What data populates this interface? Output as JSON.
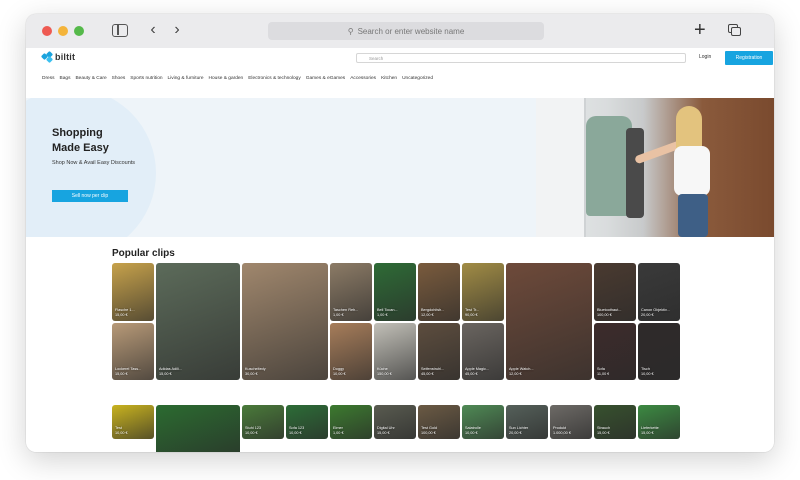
{
  "browser": {
    "url_placeholder": "Search or enter website name"
  },
  "site": {
    "logo_text": "biltit",
    "search_placeholder": "Search",
    "login_label": "Login",
    "register_label": "Registration",
    "categories": [
      "Dress",
      "Bags",
      "Beauty & Care",
      "Shoes",
      "Sports nutrition",
      "Living & furniture",
      "House & garden",
      "Electronics & technology",
      "Games & eGames",
      "Accessories",
      "Kitchen",
      "Uncategorized"
    ]
  },
  "hero": {
    "title_line1": "Shopping",
    "title_line2": "Made Easy",
    "subtitle": "Shop Now & Avail Easy Discounts",
    "button_label": "Sell now per clip"
  },
  "popular": {
    "title": "Popular clips",
    "clips": [
      {
        "label": "Flasche 1...",
        "price": "15,00 €",
        "color": "#c7a24b"
      },
      {
        "label": "Adidas Adili...",
        "price": "15,00 €",
        "color": "#5c6b5a"
      },
      {
        "label": "Kuscheltedy",
        "price": "30,00 €",
        "color": "#a0876d"
      },
      {
        "label": "Taschen Reh...",
        "price": "1,00 €",
        "color": "#8c7b66"
      },
      {
        "label": "Bell Tocan...",
        "price": "1,00 €",
        "color": "#2e6b36"
      },
      {
        "label": "Bergdohitsh...",
        "price": "12,00 €",
        "color": "#7a5b3d"
      },
      {
        "label": "Test Tr...",
        "price": "90,00 €",
        "color": "#a18c45"
      },
      {
        "label": "Apple Watch...",
        "price": "12,00 €",
        "color": "#6e4a3a"
      },
      {
        "label": "Bluetoothaut...",
        "price": "100,00 €",
        "color": "#4a3a30"
      },
      {
        "label": "Canon Objektiv...",
        "price": "20,00 €",
        "color": "#3a3a3a"
      },
      {
        "label": "Lockerel Tass...",
        "price": "15,00 €",
        "color": "#b89a78"
      },
      {
        "label": "Doggy",
        "price": "10,00 €",
        "color": "#a77d5a"
      },
      {
        "label": "Küche",
        "price": "150,00 €",
        "color": "#c2c0b8"
      },
      {
        "label": "Seifenstruhl...",
        "price": "45,00 €",
        "color": "#5d4d3e"
      },
      {
        "label": "Apple Magic...",
        "price": "45,00 €",
        "color": "#6a6560"
      },
      {
        "label": "Sofa",
        "price": "11,00 €",
        "color": "#3d2b2b"
      },
      {
        "label": "Tisch",
        "price": "10,00 €",
        "color": "#2f2a2a"
      }
    ]
  },
  "row2": {
    "clips": [
      {
        "label": "Test",
        "price": "10,00 €",
        "color": "#c9b31f"
      },
      {
        "label": "",
        "price": "",
        "color": "#2b6b30"
      },
      {
        "label": "Stuhl 123",
        "price": "10,00 €",
        "color": "#4a7a3a"
      },
      {
        "label": "Sofa 123",
        "price": "10,00 €",
        "color": "#2d6d37"
      },
      {
        "label": "Eimer",
        "price": "1,00 €",
        "color": "#3c7a2f"
      },
      {
        "label": "Digital Uhr",
        "price": "15,00 €",
        "color": "#595b50"
      },
      {
        "label": "Test Gold",
        "price": "100,00 €",
        "color": "#6b5a44"
      },
      {
        "label": "Salatrolle",
        "price": "10,00 €",
        "color": "#4f8a55"
      },
      {
        "label": "Sun Lichter",
        "price": "20,00 €",
        "color": "#55605a"
      },
      {
        "label": "Produkt",
        "price": "1.000,00 €",
        "color": "#6d6a66"
      },
      {
        "label": "Strauch",
        "price": "15,00 €",
        "color": "#37512e"
      },
      {
        "label": "Lieferkette",
        "price": "15,00 €",
        "color": "#3c8a42"
      }
    ]
  }
}
